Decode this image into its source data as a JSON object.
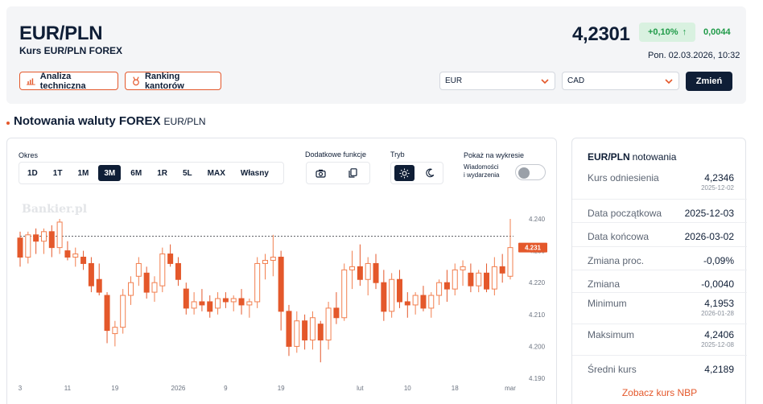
{
  "header": {
    "pair": "EUR/PLN",
    "subtitle": "Kurs EUR/PLN FOREX",
    "rate": "4,2301",
    "change_pct": "+0,10%",
    "change_arrow": "↑",
    "change_abs": "0,0044",
    "timestamp": "Pon. 02.03.2026, 10:32",
    "analysis_label": "Analiza techniczna",
    "ranking_label": "Ranking kantorów",
    "from_currency": "EUR",
    "to_currency": "CAD",
    "change_button": "Zmień"
  },
  "section": {
    "title": "Notowania waluty FOREX",
    "pair": "EUR/PLN"
  },
  "controls": {
    "period_label": "Okres",
    "periods": [
      "1D",
      "1T",
      "1M",
      "3M",
      "6M",
      "1R",
      "5L",
      "MAX",
      "Własny"
    ],
    "active_period": "3M",
    "extra_label": "Dodatkowe funkcje",
    "mode_label": "Tryb",
    "show_label": "Pokaż na wykresie",
    "events_line1": "Wiadomości",
    "events_line2": "i wydarzenia"
  },
  "chart_data": {
    "type": "candlestick",
    "watermark": "Bankier.pl",
    "x_ticks": [
      {
        "label": "3",
        "i": 0
      },
      {
        "label": "11",
        "i": 6
      },
      {
        "label": "19",
        "i": 12
      },
      {
        "label": "2026",
        "i": 20
      },
      {
        "label": "9",
        "i": 26
      },
      {
        "label": "19",
        "i": 33
      },
      {
        "label": "lut",
        "i": 43
      },
      {
        "label": "10",
        "i": 49
      },
      {
        "label": "18",
        "i": 55
      },
      {
        "label": "mar",
        "i": 62
      }
    ],
    "y_ticks": [
      "4.240",
      "4.230",
      "4.220",
      "4.210",
      "4.200",
      "4.190"
    ],
    "ylim": [
      4.19,
      4.24
    ],
    "last_price_label": "4.231",
    "last_price": 4.231,
    "dashed_ref": 4.2346,
    "candles": [
      {
        "o": 4.234,
        "h": 4.236,
        "l": 4.225,
        "c": 4.228
      },
      {
        "o": 4.228,
        "h": 4.236,
        "l": 4.226,
        "c": 4.235
      },
      {
        "o": 4.235,
        "h": 4.237,
        "l": 4.229,
        "c": 4.233
      },
      {
        "o": 4.233,
        "h": 4.237,
        "l": 4.229,
        "c": 4.236
      },
      {
        "o": 4.236,
        "h": 4.238,
        "l": 4.228,
        "c": 4.231
      },
      {
        "o": 4.231,
        "h": 4.24,
        "l": 4.229,
        "c": 4.239
      },
      {
        "o": 4.23,
        "h": 4.233,
        "l": 4.227,
        "c": 4.228
      },
      {
        "o": 4.228,
        "h": 4.231,
        "l": 4.225,
        "c": 4.229
      },
      {
        "o": 4.228,
        "h": 4.23,
        "l": 4.224,
        "c": 4.226
      },
      {
        "o": 4.226,
        "h": 4.228,
        "l": 4.217,
        "c": 4.219
      },
      {
        "o": 4.221,
        "h": 4.226,
        "l": 4.216,
        "c": 4.217
      },
      {
        "o": 4.216,
        "h": 4.217,
        "l": 4.201,
        "c": 4.205
      },
      {
        "o": 4.204,
        "h": 4.208,
        "l": 4.2,
        "c": 4.206
      },
      {
        "o": 4.206,
        "h": 4.218,
        "l": 4.204,
        "c": 4.216
      },
      {
        "o": 4.216,
        "h": 4.222,
        "l": 4.213,
        "c": 4.22
      },
      {
        "o": 4.222,
        "h": 4.228,
        "l": 4.219,
        "c": 4.226
      },
      {
        "o": 4.223,
        "h": 4.225,
        "l": 4.215,
        "c": 4.217
      },
      {
        "o": 4.217,
        "h": 4.222,
        "l": 4.214,
        "c": 4.22
      },
      {
        "o": 4.219,
        "h": 4.231,
        "l": 4.217,
        "c": 4.229
      },
      {
        "o": 4.229,
        "h": 4.232,
        "l": 4.225,
        "c": 4.226
      },
      {
        "o": 4.226,
        "h": 4.228,
        "l": 4.219,
        "c": 4.221
      },
      {
        "o": 4.218,
        "h": 4.22,
        "l": 4.21,
        "c": 4.212
      },
      {
        "o": 4.212,
        "h": 4.217,
        "l": 4.21,
        "c": 4.214
      },
      {
        "o": 4.214,
        "h": 4.218,
        "l": 4.211,
        "c": 4.213
      },
      {
        "o": 4.214,
        "h": 4.216,
        "l": 4.209,
        "c": 4.211
      },
      {
        "o": 4.212,
        "h": 4.217,
        "l": 4.21,
        "c": 4.215
      },
      {
        "o": 4.215,
        "h": 4.217,
        "l": 4.212,
        "c": 4.214
      },
      {
        "o": 4.214,
        "h": 4.216,
        "l": 4.211,
        "c": 4.215
      },
      {
        "o": 4.215,
        "h": 4.218,
        "l": 4.21,
        "c": 4.213
      },
      {
        "o": 4.213,
        "h": 4.215,
        "l": 4.209,
        "c": 4.214
      },
      {
        "o": 4.214,
        "h": 4.228,
        "l": 4.212,
        "c": 4.226
      },
      {
        "o": 4.226,
        "h": 4.229,
        "l": 4.221,
        "c": 4.227
      },
      {
        "o": 4.227,
        "h": 4.235,
        "l": 4.222,
        "c": 4.228
      },
      {
        "o": 4.228,
        "h": 4.23,
        "l": 4.205,
        "c": 4.211
      },
      {
        "o": 4.211,
        "h": 4.213,
        "l": 4.197,
        "c": 4.2
      },
      {
        "o": 4.2,
        "h": 4.211,
        "l": 4.198,
        "c": 4.208
      },
      {
        "o": 4.208,
        "h": 4.21,
        "l": 4.199,
        "c": 4.202
      },
      {
        "o": 4.202,
        "h": 4.211,
        "l": 4.199,
        "c": 4.209
      },
      {
        "o": 4.207,
        "h": 4.208,
        "l": 4.195,
        "c": 4.202
      },
      {
        "o": 4.202,
        "h": 4.214,
        "l": 4.199,
        "c": 4.212
      },
      {
        "o": 4.212,
        "h": 4.217,
        "l": 4.207,
        "c": 4.209
      },
      {
        "o": 4.209,
        "h": 4.226,
        "l": 4.208,
        "c": 4.224
      },
      {
        "o": 4.224,
        "h": 4.23,
        "l": 4.218,
        "c": 4.225
      },
      {
        "o": 4.225,
        "h": 4.232,
        "l": 4.219,
        "c": 4.221
      },
      {
        "o": 4.221,
        "h": 4.228,
        "l": 4.216,
        "c": 4.226
      },
      {
        "o": 4.226,
        "h": 4.229,
        "l": 4.218,
        "c": 4.22
      },
      {
        "o": 4.22,
        "h": 4.224,
        "l": 4.208,
        "c": 4.211
      },
      {
        "o": 4.211,
        "h": 4.223,
        "l": 4.209,
        "c": 4.221
      },
      {
        "o": 4.221,
        "h": 4.224,
        "l": 4.212,
        "c": 4.214
      },
      {
        "o": 4.214,
        "h": 4.217,
        "l": 4.209,
        "c": 4.213
      },
      {
        "o": 4.213,
        "h": 4.217,
        "l": 4.21,
        "c": 4.216
      },
      {
        "o": 4.216,
        "h": 4.219,
        "l": 4.211,
        "c": 4.212
      },
      {
        "o": 4.212,
        "h": 4.217,
        "l": 4.209,
        "c": 4.216
      },
      {
        "o": 4.216,
        "h": 4.221,
        "l": 4.213,
        "c": 4.22
      },
      {
        "o": 4.22,
        "h": 4.224,
        "l": 4.214,
        "c": 4.218
      },
      {
        "o": 4.218,
        "h": 4.226,
        "l": 4.216,
        "c": 4.224
      },
      {
        "o": 4.224,
        "h": 4.227,
        "l": 4.219,
        "c": 4.225
      },
      {
        "o": 4.223,
        "h": 4.226,
        "l": 4.217,
        "c": 4.219
      },
      {
        "o": 4.219,
        "h": 4.224,
        "l": 4.217,
        "c": 4.223
      },
      {
        "o": 4.223,
        "h": 4.226,
        "l": 4.217,
        "c": 4.218
      },
      {
        "o": 4.218,
        "h": 4.228,
        "l": 4.216,
        "c": 4.225
      },
      {
        "o": 4.225,
        "h": 4.229,
        "l": 4.22,
        "c": 4.223
      },
      {
        "o": 4.222,
        "h": 4.24,
        "l": 4.221,
        "c": 4.231
      }
    ],
    "colors": {
      "up": "#f27f4f",
      "down": "#e4582b",
      "hollow_fill": "#ffffff",
      "last_label_bg": "#e4582b"
    }
  },
  "quotes": {
    "title": "EUR/PLN",
    "title_suffix": "notowania",
    "rows": [
      {
        "label": "Kurs odniesienia",
        "value": "4,2346",
        "date": "2025-12-02"
      },
      {
        "label": "Data początkowa",
        "value": "2025-12-03",
        "date": ""
      },
      {
        "label": "Data końcowa",
        "value": "2026-03-02",
        "date": ""
      },
      {
        "label": "Zmiana proc.",
        "value": "-0,09%",
        "date": ""
      },
      {
        "label": "Zmiana",
        "value": "-0,0040",
        "date": ""
      },
      {
        "label": "Minimum",
        "value": "4,1953",
        "date": "2026-01-28"
      },
      {
        "label": "Maksimum",
        "value": "4,2406",
        "date": "2025-12-08"
      },
      {
        "label": "Średni kurs",
        "value": "4,2189",
        "date": ""
      }
    ],
    "nbp_link": "Zobacz kurs NBP"
  },
  "colors": {
    "accent": "#e4582b",
    "navy": "#0f1e36",
    "green": "#1f9a48",
    "green_bg": "#d9f1e0"
  }
}
